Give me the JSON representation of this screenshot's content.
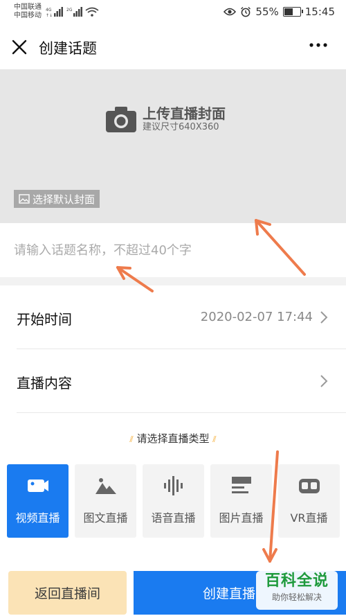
{
  "status_bar": {
    "carrier_1": "中国联通",
    "carrier_2": "中国移动",
    "network_1": "4G",
    "network_2": "2G",
    "battery": "55%",
    "battery_level": 55,
    "time": "15:45"
  },
  "header": {
    "title": "创建话题",
    "close_icon": "close-icon",
    "more_icon": "more-icon"
  },
  "cover": {
    "upload_title": "上传直播封面",
    "upload_hint": "建议尺寸640X360",
    "default_cover_label": "选择默认封面"
  },
  "topic_input": {
    "value": "",
    "placeholder": "请输入话题名称，不超过40个字"
  },
  "form": {
    "start_time_label": "开始时间",
    "start_time_value": "2020-02-07 17:44",
    "content_label": "直播内容"
  },
  "live_type": {
    "heading": "请选择直播类型",
    "options": [
      {
        "label": "视频直播",
        "icon": "video-camera-icon",
        "selected": true
      },
      {
        "label": "图文直播",
        "icon": "image-mountain-icon",
        "selected": false
      },
      {
        "label": "语音直播",
        "icon": "audio-wave-icon",
        "selected": false
      },
      {
        "label": "图片直播",
        "icon": "picture-list-icon",
        "selected": false
      },
      {
        "label": "VR直播",
        "icon": "vr-headset-icon",
        "selected": false
      }
    ]
  },
  "actions": {
    "back_label": "返回直播间",
    "create_label": "创建直播"
  },
  "watermark": {
    "title": "百科全说",
    "subtitle": "助你轻松解决"
  },
  "colors": {
    "accent": "#1a7bf0",
    "back_button": "#fbe3b6",
    "annotation_arrow": "#ee7b4c"
  }
}
